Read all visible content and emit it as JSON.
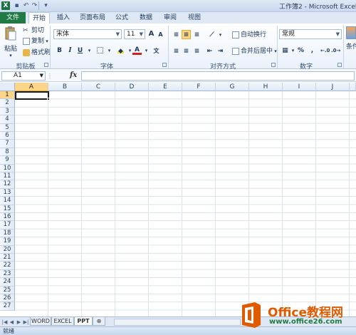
{
  "titlebar": {
    "app_icon": "X",
    "title": "工作簿2 - Microsoft Excel"
  },
  "tabs": {
    "file": "文件",
    "items": [
      "开始",
      "插入",
      "页面布局",
      "公式",
      "数据",
      "审阅",
      "视图"
    ]
  },
  "ribbon": {
    "clipboard": {
      "paste": "粘贴",
      "cut": "剪切",
      "copy": "复制",
      "format_painter": "格式刷",
      "label": "剪贴板"
    },
    "font": {
      "font_name": "宋体",
      "font_size": "11",
      "label": "字体",
      "bold": "B",
      "italic": "I",
      "underline": "U",
      "grow": "A",
      "shrink": "A"
    },
    "alignment": {
      "wrap_text": "自动换行",
      "merge_center": "合并后居中",
      "label": "对齐方式"
    },
    "number": {
      "format": "常规",
      "percent": "%",
      "comma": ",",
      "label": "数字"
    },
    "styles": {
      "conditional": "条件"
    }
  },
  "formulabar": {
    "name_box": "A1",
    "fx": "fx",
    "value": ""
  },
  "grid": {
    "columns": [
      "A",
      "B",
      "C",
      "D",
      "E",
      "F",
      "G",
      "H",
      "I",
      "J"
    ],
    "rows": [
      "1",
      "2",
      "3",
      "4",
      "5",
      "6",
      "7",
      "8",
      "9",
      "10",
      "11",
      "12",
      "13",
      "14",
      "15",
      "16",
      "17",
      "18",
      "19",
      "20",
      "21",
      "22",
      "23",
      "24",
      "25",
      "26",
      "27"
    ],
    "active_cell": "A1"
  },
  "sheets": {
    "tabs": [
      "WORD",
      "EXCEL",
      "PPT"
    ],
    "active": "PPT"
  },
  "status": {
    "text": "就绪"
  },
  "watermark": {
    "brand": "Office教程网",
    "sub": "www.office26.com"
  },
  "colors": {
    "file_tab": "#1f7a43",
    "selection_header": "#fbd68a",
    "watermark_orange": "#e05a00"
  }
}
